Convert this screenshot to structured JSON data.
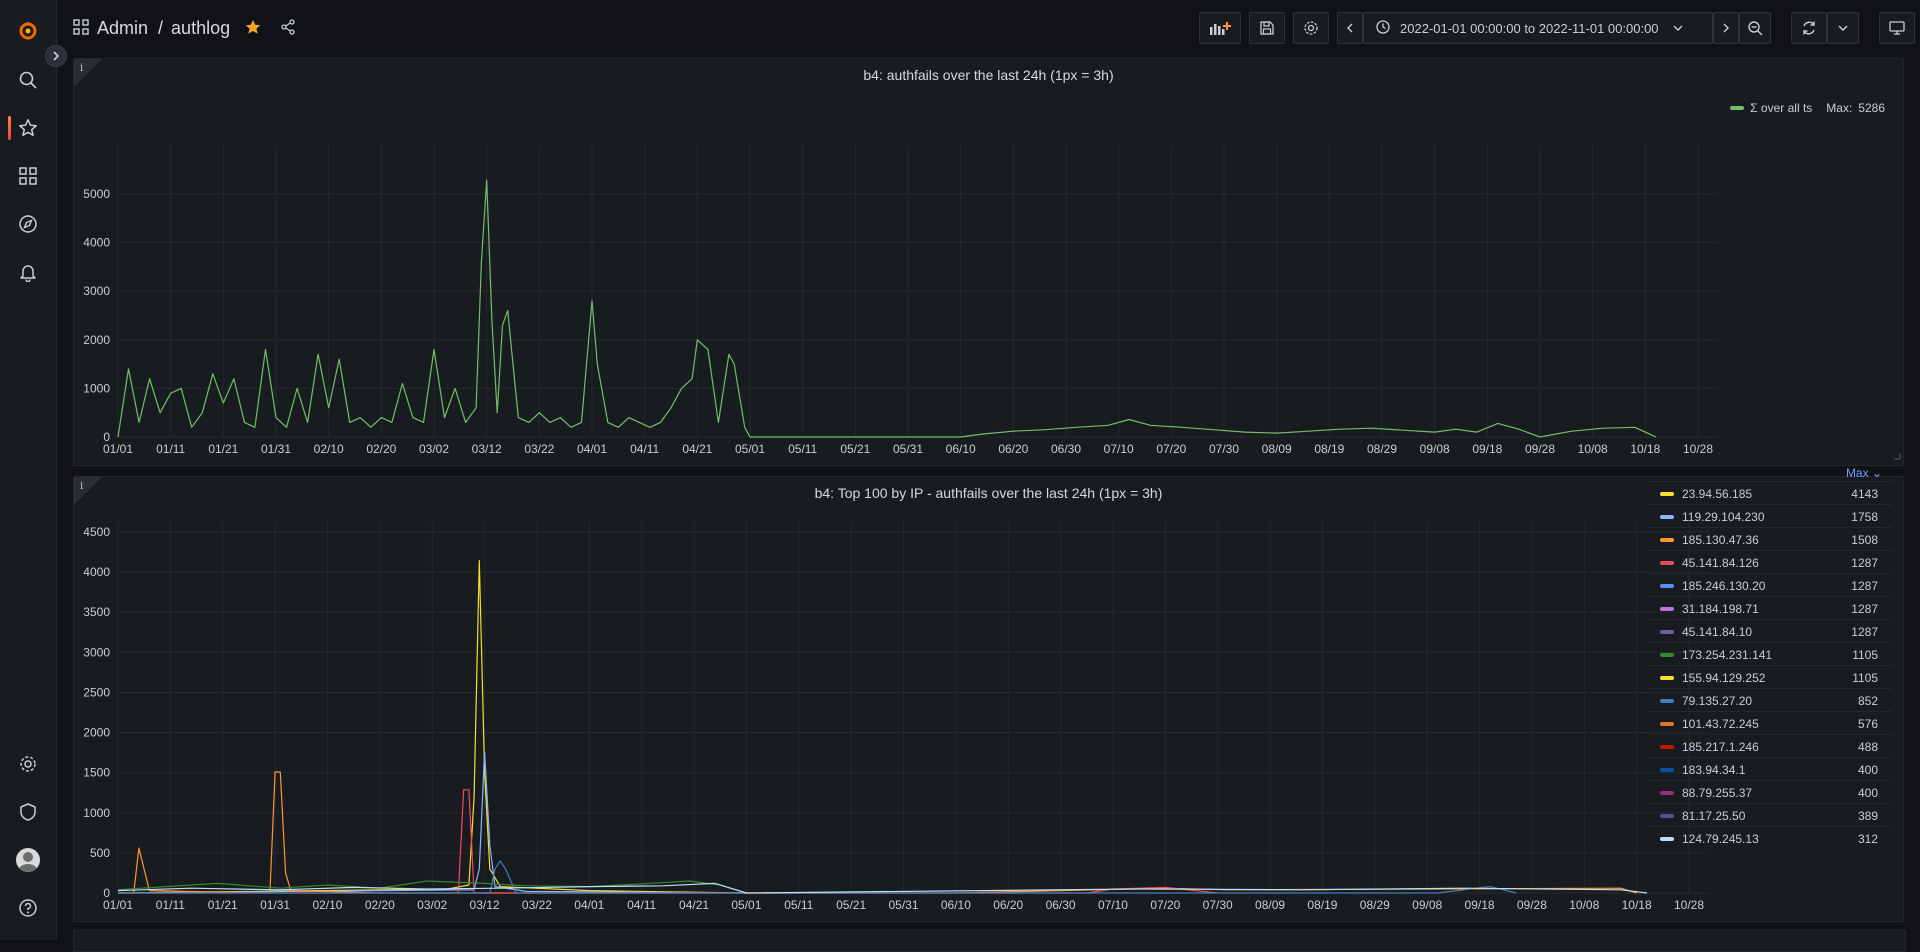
{
  "breadcrumb": {
    "folder": "Admin",
    "separator": "/",
    "dashboard": "authlog"
  },
  "toolbar": {
    "time_range": "2022-01-01 00:00:00 to 2022-11-01 00:00:00"
  },
  "colors": {
    "accent": "#ff8833",
    "star": "#f5a623",
    "green": "#73bf69",
    "legend_header": "#6e9fff"
  },
  "sidebar": {
    "icons": [
      "grafana-logo-icon",
      "search-icon",
      "starred-icon",
      "dashboards-icon",
      "explore-icon",
      "alerting-icon",
      "configuration-icon",
      "server-admin-icon",
      "user-avatar",
      "help-icon"
    ]
  },
  "panels": [
    {
      "title": "b4: authfails over the last 24h (1px = 3h)",
      "corner_icon": "i",
      "legend": {
        "series_name": "Σ over all ts",
        "stat_label": "Max:",
        "stat_value": "5286",
        "color": "#73bf69"
      },
      "chart_data": {
        "type": "line",
        "x_ticks": [
          "01/01",
          "01/11",
          "01/21",
          "01/31",
          "02/10",
          "02/20",
          "03/02",
          "03/12",
          "03/22",
          "04/01",
          "04/11",
          "04/21",
          "05/01",
          "05/11",
          "05/21",
          "05/31",
          "06/10",
          "06/20",
          "06/30",
          "07/10",
          "07/20",
          "07/30",
          "08/09",
          "08/19",
          "08/29",
          "09/08",
          "09/18",
          "09/28",
          "10/08",
          "10/18",
          "10/28"
        ],
        "y_ticks": [
          "0",
          "1000",
          "2000",
          "3000",
          "4000",
          "5000"
        ],
        "ylim": [
          0,
          5800
        ],
        "series": [
          {
            "name": "Σ over all ts",
            "color": "#73bf69",
            "x": [
              "01/01",
              "01/03",
              "01/05",
              "01/07",
              "01/09",
              "01/11",
              "01/13",
              "01/15",
              "01/17",
              "01/19",
              "01/21",
              "01/23",
              "01/25",
              "01/27",
              "01/29",
              "01/31",
              "02/02",
              "02/04",
              "02/06",
              "02/08",
              "02/10",
              "02/12",
              "02/14",
              "02/16",
              "02/18",
              "02/20",
              "02/22",
              "02/24",
              "02/26",
              "02/28",
              "03/02",
              "03/04",
              "03/06",
              "03/08",
              "03/10",
              "03/11",
              "03/12",
              "03/13",
              "03/14",
              "03/15",
              "03/16",
              "03/18",
              "03/20",
              "03/22",
              "03/24",
              "03/26",
              "03/28",
              "03/30",
              "04/01",
              "04/02",
              "04/04",
              "04/06",
              "04/08",
              "04/10",
              "04/12",
              "04/14",
              "04/16",
              "04/18",
              "04/20",
              "04/21",
              "04/23",
              "04/25",
              "04/27",
              "04/28",
              "04/30",
              "05/01",
              "06/10",
              "06/14",
              "06/20",
              "06/26",
              "07/02",
              "07/08",
              "07/12",
              "07/16",
              "07/22",
              "07/28",
              "08/03",
              "08/09",
              "08/15",
              "08/21",
              "08/27",
              "09/02",
              "09/08",
              "09/12",
              "09/16",
              "09/20",
              "09/24",
              "09/28",
              "10/04",
              "10/10",
              "10/16",
              "10/20"
            ],
            "values": [
              0,
              1400,
              300,
              1200,
              500,
              900,
              1000,
              200,
              500,
              1300,
              700,
              1200,
              300,
              200,
              1800,
              400,
              200,
              1000,
              300,
              1700,
              600,
              1600,
              300,
              400,
              200,
              400,
              300,
              1100,
              400,
              300,
              1800,
              400,
              1000,
              300,
              600,
              3600,
              5286,
              2400,
              500,
              2300,
              2600,
              400,
              300,
              500,
              300,
              400,
              200,
              300,
              2800,
              1500,
              300,
              200,
              400,
              300,
              200,
              300,
              600,
              1000,
              1200,
              2000,
              1800,
              300,
              1700,
              1500,
              200,
              0,
              0,
              60,
              120,
              150,
              200,
              240,
              360,
              240,
              200,
              150,
              100,
              80,
              120,
              160,
              180,
              140,
              100,
              160,
              100,
              280,
              160,
              0,
              120,
              180,
              200,
              0
            ]
          }
        ]
      }
    },
    {
      "title": "b4: Top 100 by IP - authfails over the last 24h (1px = 3h)",
      "corner_icon": "i",
      "legend_header": "Max",
      "legend": [
        {
          "name": "23.94.56.185",
          "value": "4143",
          "color": "#fade2a"
        },
        {
          "name": "119.29.104.230",
          "value": "1758",
          "color": "#8ab8ff"
        },
        {
          "name": "185.130.47.36",
          "value": "1508",
          "color": "#ff9830"
        },
        {
          "name": "45.141.84.126",
          "value": "1287",
          "color": "#f2495c"
        },
        {
          "name": "185.246.130.20",
          "value": "1287",
          "color": "#5794f2"
        },
        {
          "name": "31.184.198.71",
          "value": "1287",
          "color": "#b877d9"
        },
        {
          "name": "45.141.84.10",
          "value": "1287",
          "color": "#705da0"
        },
        {
          "name": "173.254.231.141",
          "value": "1105",
          "color": "#37872d"
        },
        {
          "name": "155.94.129.252",
          "value": "1105",
          "color": "#fade2a"
        },
        {
          "name": "79.135.27.20",
          "value": "852",
          "color": "#447ebc"
        },
        {
          "name": "101.43.72.245",
          "value": "576",
          "color": "#e0752d"
        },
        {
          "name": "185.217.1.246",
          "value": "488",
          "color": "#bf1b00"
        },
        {
          "name": "183.94.34.1",
          "value": "400",
          "color": "#0a50a1"
        },
        {
          "name": "88.79.255.37",
          "value": "400",
          "color": "#962d82"
        },
        {
          "name": "81.17.25.50",
          "value": "389",
          "color": "#614d93"
        },
        {
          "name": "124.79.245.13",
          "value": "312",
          "color": "#badff4"
        }
      ],
      "chart_data": {
        "type": "line",
        "x_ticks": [
          "01/01",
          "01/11",
          "01/21",
          "01/31",
          "02/10",
          "02/20",
          "03/02",
          "03/12",
          "03/22",
          "04/01",
          "04/11",
          "04/21",
          "05/01",
          "05/11",
          "05/21",
          "05/31",
          "06/10",
          "06/20",
          "06/30",
          "07/10",
          "07/20",
          "07/30",
          "08/09",
          "08/19",
          "08/29",
          "09/08",
          "09/18",
          "09/28",
          "10/08",
          "10/18",
          "10/28"
        ],
        "y_ticks": [
          "0",
          "500",
          "1000",
          "1500",
          "2000",
          "2500",
          "3000",
          "3500",
          "4000",
          "4500"
        ],
        "ylim": [
          0,
          4500
        ],
        "series": [
          {
            "name": "23.94.56.185",
            "color": "#fade2a",
            "x": [
              "01/01",
              "03/05",
              "03/09",
              "03/10",
              "03/11",
              "03/12",
              "03/13",
              "03/15",
              "04/01",
              "05/01"
            ],
            "values": [
              0,
              50,
              100,
              1200,
              4143,
              1500,
              300,
              80,
              30,
              0
            ]
          },
          {
            "name": "119.29.104.230",
            "color": "#8ab8ff",
            "x": [
              "01/01",
              "03/10",
              "03/11",
              "03/12",
              "03/13",
              "03/14",
              "03/20",
              "05/01"
            ],
            "values": [
              0,
              40,
              300,
              1758,
              600,
              80,
              20,
              0
            ]
          },
          {
            "name": "185.130.47.36",
            "color": "#ff9830",
            "x": [
              "01/01",
              "01/04",
              "01/05",
              "01/07",
              "01/30",
              "01/31",
              "02/01",
              "02/02",
              "02/03",
              "02/20",
              "05/01",
              "06/10",
              "07/20",
              "08/01",
              "10/15",
              "10/18"
            ],
            "values": [
              0,
              0,
              560,
              30,
              0,
              1508,
              1508,
              250,
              30,
              0,
              0,
              0,
              60,
              40,
              60,
              0
            ]
          },
          {
            "name": "45.141.84.126",
            "color": "#f2495c",
            "x": [
              "01/01",
              "03/07",
              "03/08",
              "03/09",
              "03/10",
              "03/20",
              "05/01",
              "07/05",
              "07/10",
              "07/20",
              "07/30"
            ],
            "values": [
              0,
              0,
              1287,
              1287,
              0,
              0,
              0,
              0,
              50,
              70,
              0
            ]
          },
          {
            "name": "79.135.27.20",
            "color": "#447ebc",
            "x": [
              "01/01",
              "03/12",
              "03/13",
              "03/14",
              "03/15",
              "03/16",
              "03/18",
              "05/01",
              "09/10",
              "09/20",
              "09/25"
            ],
            "values": [
              0,
              0,
              0,
              300,
              400,
              300,
              0,
              0,
              0,
              80,
              0
            ]
          },
          {
            "name": "173.254.231.141",
            "color": "#37872d",
            "x": [
              "01/01",
              "01/10",
              "01/20",
              "02/01",
              "02/10",
              "02/20",
              "03/01",
              "03/12",
              "03/20",
              "04/01",
              "04/10",
              "04/20",
              "04/26",
              "05/01"
            ],
            "values": [
              40,
              80,
              120,
              60,
              100,
              60,
              150,
              120,
              90,
              80,
              110,
              150,
              100,
              0
            ]
          },
          {
            "name": "124.79.245.13",
            "color": "#badff4",
            "x": [
              "01/01",
              "01/15",
              "02/01",
              "02/15",
              "03/01",
              "03/15",
              "04/01",
              "04/15",
              "04/25",
              "05/01",
              "06/15",
              "07/15",
              "08/15",
              "09/15",
              "10/15",
              "10/20"
            ],
            "values": [
              30,
              60,
              40,
              70,
              50,
              60,
              80,
              90,
              120,
              0,
              30,
              50,
              40,
              60,
              40,
              0
            ]
          }
        ]
      }
    }
  ]
}
